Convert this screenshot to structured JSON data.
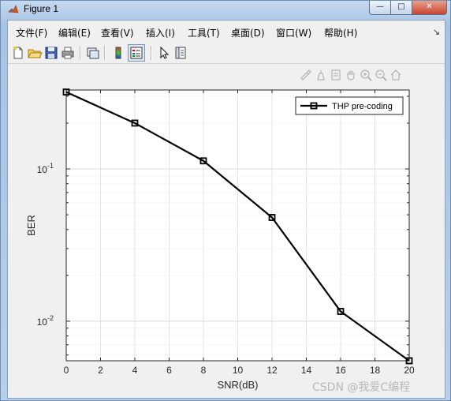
{
  "window": {
    "title": "Figure 1",
    "minimize_glyph": "—",
    "maximize_glyph": "□",
    "close_glyph": "✕"
  },
  "menu": {
    "items": [
      "文件(F)",
      "编辑(E)",
      "查看(V)",
      "插入(I)",
      "工具(T)",
      "桌面(D)",
      "窗口(W)",
      "帮助(H)"
    ],
    "overflow_glyph": "↘"
  },
  "toolbar": {
    "icons": [
      "new-figure-icon",
      "open-file-icon",
      "save-icon",
      "print-icon",
      "link-plot-icon",
      "colorbar-icon",
      "legend-icon",
      "pointer-icon",
      "property-editor-icon"
    ]
  },
  "axes_toolbar": {
    "icons": [
      "brush-icon",
      "data-tips-icon",
      "export-icon",
      "pan-icon",
      "zoom-in-icon",
      "zoom-out-icon",
      "home-icon"
    ]
  },
  "chart_data": {
    "type": "line",
    "title": "",
    "xlabel": "SNR(dB)",
    "ylabel": "BER",
    "xlim": [
      0,
      20
    ],
    "ylim": [
      0.0055,
      0.33
    ],
    "yscale": "log",
    "grid": true,
    "x_ticks": [
      "0",
      "2",
      "4",
      "6",
      "8",
      "10",
      "12",
      "14",
      "16",
      "18",
      "20"
    ],
    "y_ticks": [
      {
        "value": 0.1,
        "base": "10",
        "exp": "-1"
      },
      {
        "value": 0.01,
        "base": "10",
        "exp": "-2"
      }
    ],
    "legend_position": "top-right",
    "series": [
      {
        "name": "THP pre-coding",
        "color": "#000000",
        "marker": "square",
        "x": [
          0,
          4,
          8,
          12,
          16,
          20
        ],
        "y": [
          0.32,
          0.2,
          0.113,
          0.048,
          0.0116,
          0.0055
        ]
      }
    ]
  },
  "watermark": "CSDN @我爱C编程"
}
